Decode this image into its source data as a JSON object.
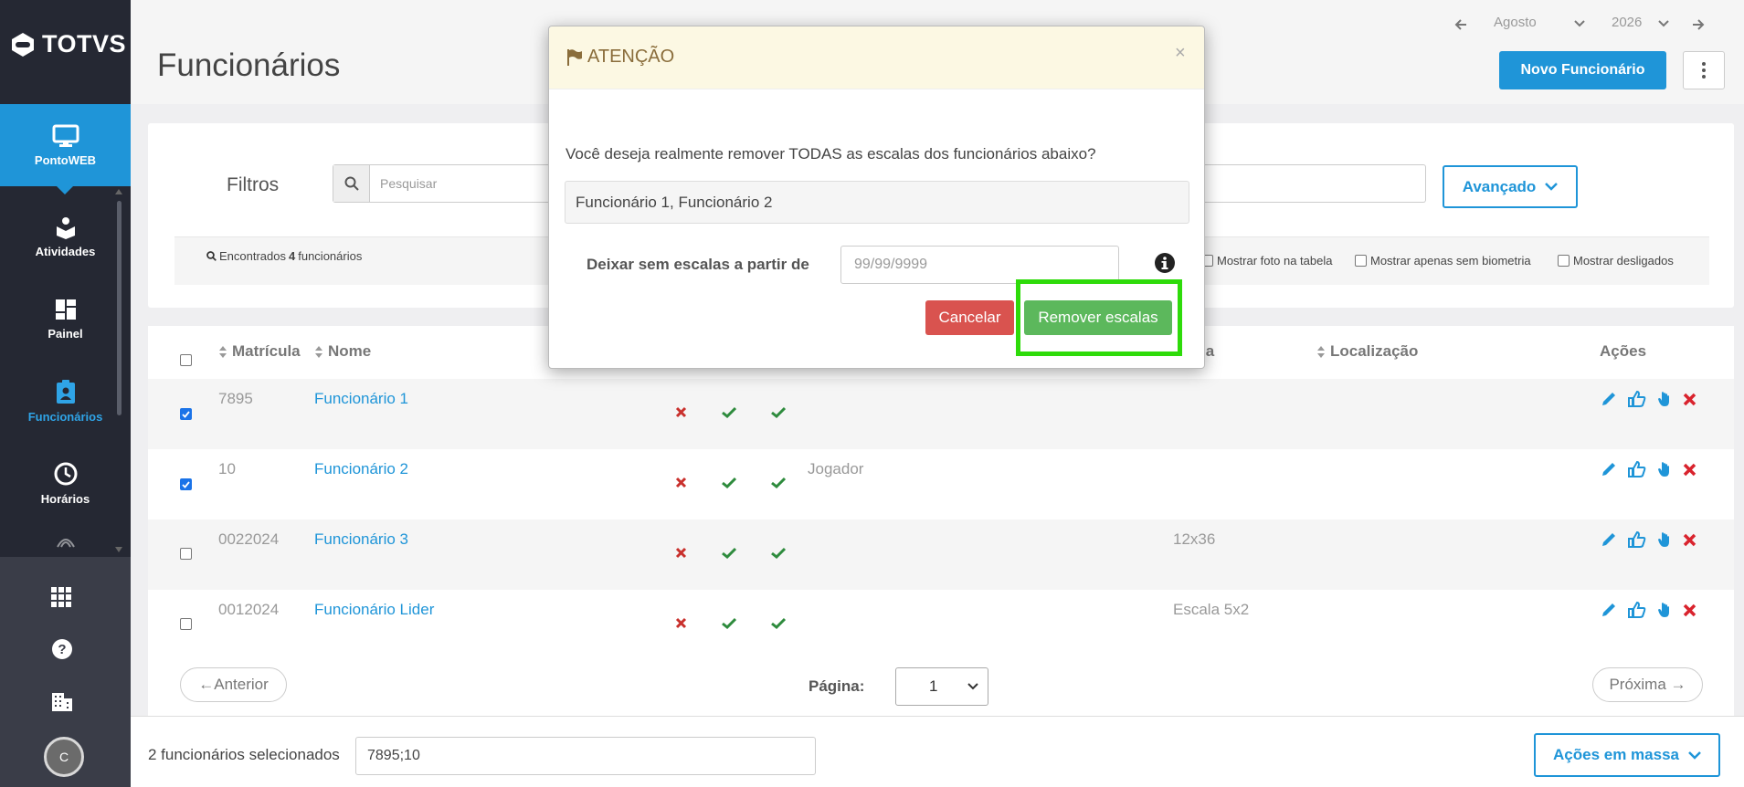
{
  "sidebar": {
    "logo": "TOTVS",
    "items": [
      {
        "label": "PontoWEB",
        "icon": "monitor-icon"
      },
      {
        "label": "Atividades",
        "icon": "activities-icon"
      },
      {
        "label": "Painel",
        "icon": "dashboard-icon"
      },
      {
        "label": "Funcionários",
        "icon": "employee-badge-icon"
      },
      {
        "label": "Horários",
        "icon": "clock-icon"
      }
    ],
    "bottom_icons": [
      "apps-grid-icon",
      "help-icon",
      "building-icon"
    ],
    "avatar_letter": "C"
  },
  "header": {
    "title": "Funcionários",
    "month": "Agosto",
    "year": "2026",
    "new_button": "Novo Funcionário"
  },
  "filters": {
    "label": "Filtros",
    "search_placeholder": "Pesquisar",
    "advanced_button": "Avançado",
    "found_prefix": "Encontrados",
    "found_count": "4",
    "found_suffix": "funcionários",
    "options": [
      "Mostrar foto na tabela",
      "Mostrar apenas sem biometria",
      "Mostrar desligados"
    ]
  },
  "table": {
    "headers": {
      "matricula": "Matrícula",
      "nome": "Nome",
      "escala": "la",
      "localizacao": "Localização",
      "acoes": "Ações"
    },
    "rows": [
      {
        "matricula": "7895",
        "nome": "Funcionário 1",
        "cargo": "",
        "escala": "",
        "checked": true
      },
      {
        "matricula": "10",
        "nome": "Funcionário 2",
        "cargo": "Jogador",
        "escala": "",
        "checked": true
      },
      {
        "matricula": "0022024",
        "nome": "Funcionário 3",
        "cargo": "",
        "escala": "12x36",
        "checked": false
      },
      {
        "matricula": "0012024",
        "nome": "Funcionário Lider",
        "cargo": "",
        "escala": "Escala 5x2",
        "checked": false
      }
    ]
  },
  "pagination": {
    "prev": "←Anterior",
    "next": "Próxima →",
    "page_label": "Página:",
    "page_value": "1"
  },
  "footer": {
    "selected_text": "2 funcionários selecionados",
    "selected_ids": "7895;10",
    "mass_actions": "Ações em massa"
  },
  "modal": {
    "title": "ATENÇÃO",
    "close": "×",
    "question": "Você deseja realmente remover TODAS as escalas dos funcionários abaixo?",
    "names": "Funcionário 1, Funcionário 2",
    "date_label": "Deixar sem escalas a partir de",
    "date_placeholder": "99/99/9999",
    "cancel": "Cancelar",
    "confirm": "Remover escalas"
  },
  "colors": {
    "sidebar": "#252833",
    "primary": "#1f95d8",
    "danger": "#d9534f",
    "success": "#5cb85c",
    "highlight": "#2edb0a",
    "warning_bg": "#fcf8e3"
  }
}
